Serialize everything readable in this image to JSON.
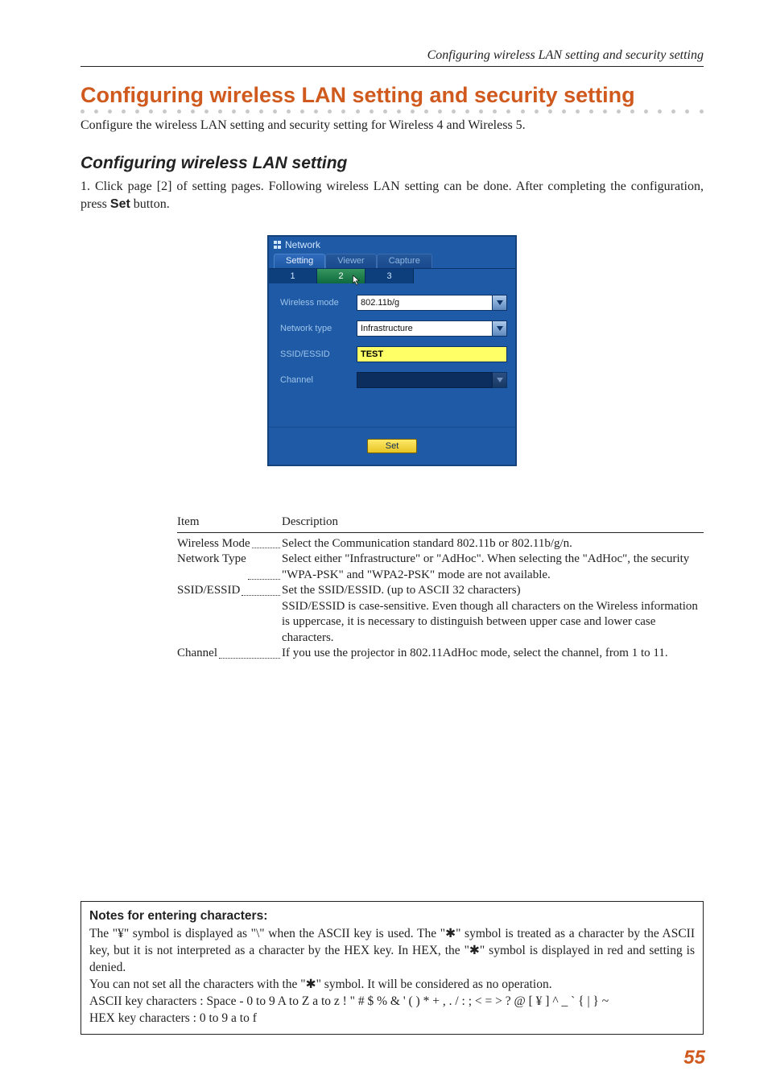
{
  "runningHead": "Configuring wireless LAN setting and security setting",
  "sectionTitle": "Configuring wireless LAN setting and security setting",
  "intro": "Configure the wireless LAN setting and security setting for Wireless 4 and Wireless 5.",
  "subTitle": "Configuring wireless LAN setting",
  "step": {
    "prefix": "1. Click page [2] of setting pages. Following wireless LAN setting can be done. After completing the configuration, press ",
    "bold": "Set",
    "suffix": " button."
  },
  "ui": {
    "windowTitle": "Network",
    "tabs": {
      "a": "Setting",
      "b": "Viewer",
      "c": "Capture"
    },
    "subtabs": {
      "a": "1",
      "b": "2",
      "c": "3"
    },
    "rows": {
      "wirelessMode": {
        "label": "Wireless mode",
        "value": "802.11b/g"
      },
      "networkType": {
        "label": "Network type",
        "value": "Infrastructure"
      },
      "ssid": {
        "label": "SSID/ESSID",
        "value": "TEST"
      },
      "channel": {
        "label": "Channel",
        "value": ""
      }
    },
    "setButton": "Set"
  },
  "desc": {
    "itemHdr": "Item",
    "descHdr": "Description",
    "wirelessMode": {
      "label": "Wireless Mode",
      "text": "Select the Communication standard 802.11b or 802.11b/g/n."
    },
    "networkType": {
      "label": "Network Type",
      "text": "Select either \"Infrastructure\" or \"AdHoc\". When selecting the \"AdHoc\", the security \"WPA-PSK\" and \"WPA2-PSK\" mode are not available."
    },
    "ssid": {
      "label": "SSID/ESSID",
      "text": "Set the SSID/ESSID. (up to ASCII 32 characters)",
      "text2": "SSID/ESSID is case-sensitive. Even though all characters on the Wireless information is uppercase, it is necessary to distinguish between upper case and lower case characters."
    },
    "channel": {
      "label": "Channel",
      "text": "If you use the projector in 802.11AdHoc mode, select the channel, from 1 to 11."
    }
  },
  "notes": {
    "title": "Notes for entering characters:",
    "p1": "The \"¥\" symbol is displayed as \"\\\" when the ASCII key is used. The \"✱\" symbol is treated as a character by the ASCII key, but it is not interpreted as a character by the HEX key. In HEX, the \"✱\" symbol is displayed in red and setting is denied.",
    "p2": "You can not set all the characters with the \"✱\" symbol. It will be considered as no operation.",
    "p3": "ASCII key characters : Space - 0 to 9 A to Z a to z ! \" # $ % & ' ( ) * + , . / : ; < = > ? @ [ ¥ ] ^ _ ` { | } ~",
    "p4": "HEX key characters : 0 to 9 a to f"
  },
  "pageNumber": "55"
}
